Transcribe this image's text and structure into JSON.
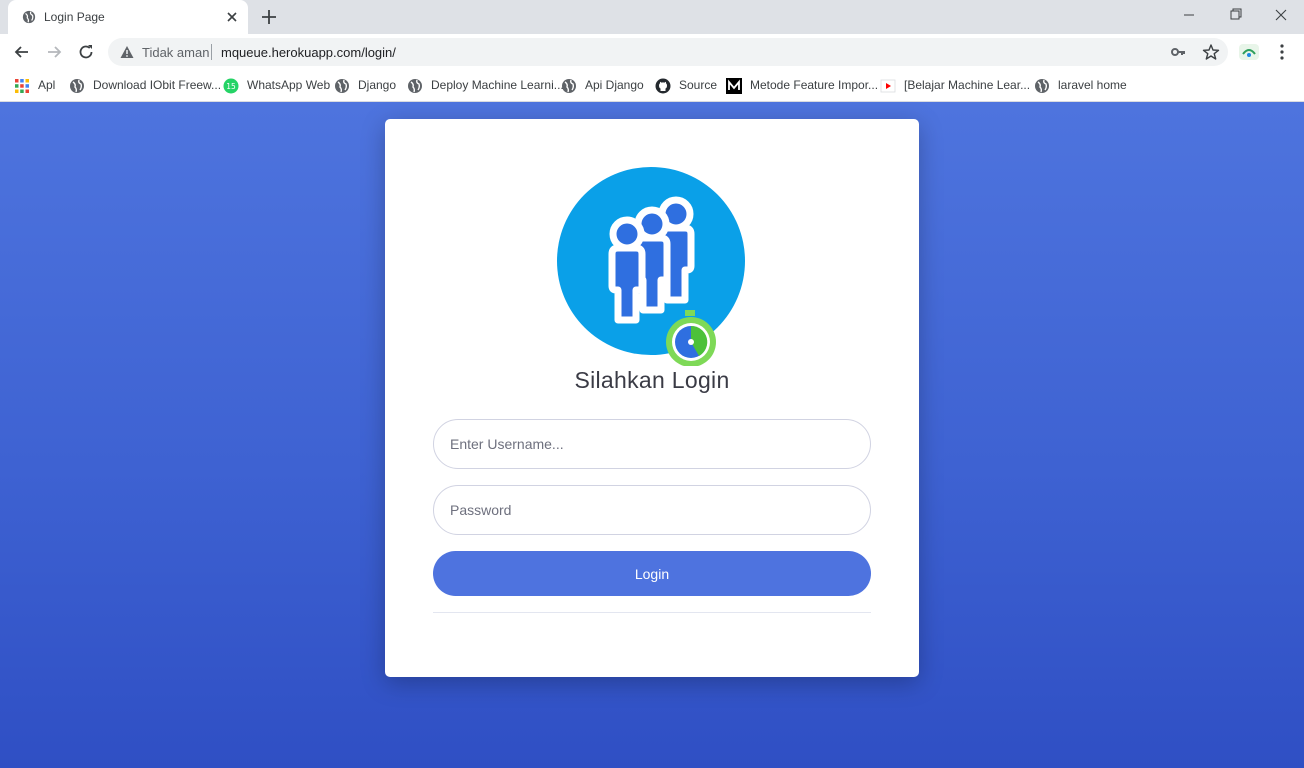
{
  "browser": {
    "tab": {
      "title": "Login Page"
    },
    "omnibox": {
      "security_label": "Tidak aman",
      "url": "mqueue.herokuapp.com/login/"
    },
    "bookmarks": [
      {
        "label": "Apl",
        "icon": "apps-grid-icon"
      },
      {
        "label": "Download IObit Freew...",
        "icon": "globe-icon"
      },
      {
        "label": "WhatsApp Web",
        "icon": "whatsapp-icon",
        "badge": "15"
      },
      {
        "label": "Django",
        "icon": "globe-icon"
      },
      {
        "label": "Deploy Machine Learni...",
        "icon": "globe-icon"
      },
      {
        "label": "Api Django",
        "icon": "globe-icon"
      },
      {
        "label": "Source",
        "icon": "github-icon"
      },
      {
        "label": "Metode Feature Impor...",
        "icon": "medium-icon"
      },
      {
        "label": "[Belajar Machine Lear...",
        "icon": "youtube-icon"
      },
      {
        "label": "laravel home",
        "icon": "globe-icon"
      }
    ]
  },
  "login": {
    "title": "Silahkan Login",
    "username_placeholder": "Enter Username...",
    "password_placeholder": "Password",
    "button_label": "Login"
  },
  "colors": {
    "primary": "#4e73df",
    "background_top": "#4e74de",
    "background_bottom": "#2f4fc4",
    "logo_circle": "#0aa0e8"
  }
}
